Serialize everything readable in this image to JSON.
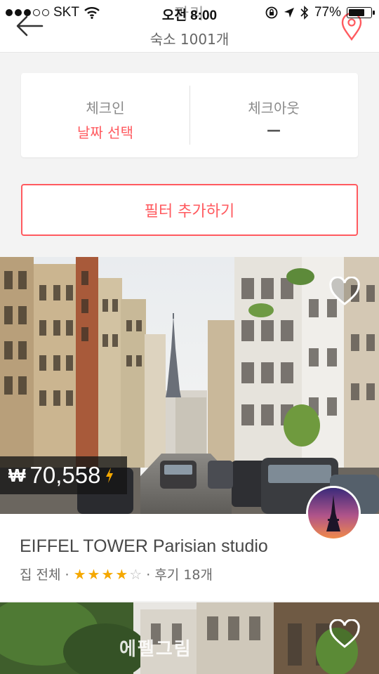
{
  "status_bar": {
    "carrier": "SKT",
    "time": "오전 8:00",
    "battery": "77%",
    "battery_level": 0.77
  },
  "header": {
    "title": "파리",
    "subtitle": "숙소 1001개"
  },
  "dates": {
    "checkin_label": "체크인",
    "checkin_value": "날짜 선택",
    "checkout_label": "체크아웃",
    "checkout_value": "—"
  },
  "filter": {
    "label": "필터 추가하기"
  },
  "listing": {
    "price_currency": "₩",
    "price": "70,558",
    "title": "EIFFEL TOWER  Parisian studio",
    "room_type": "집 전체 ·",
    "rating": 4,
    "rating_max": 5,
    "reviews": "· 후기 18개"
  },
  "listing2": {
    "watermark": "에펠그림"
  },
  "colors": {
    "accent": "#ff5a5f",
    "star": "#f5a800",
    "text": "#484848"
  },
  "icons": [
    "back-arrow-icon",
    "map-pin-icon",
    "heart-icon",
    "instant-book-bolt-icon",
    "star-icon",
    "wifi-icon",
    "location-arrow-icon",
    "bluetooth-icon",
    "orientation-lock-icon",
    "battery-icon"
  ]
}
